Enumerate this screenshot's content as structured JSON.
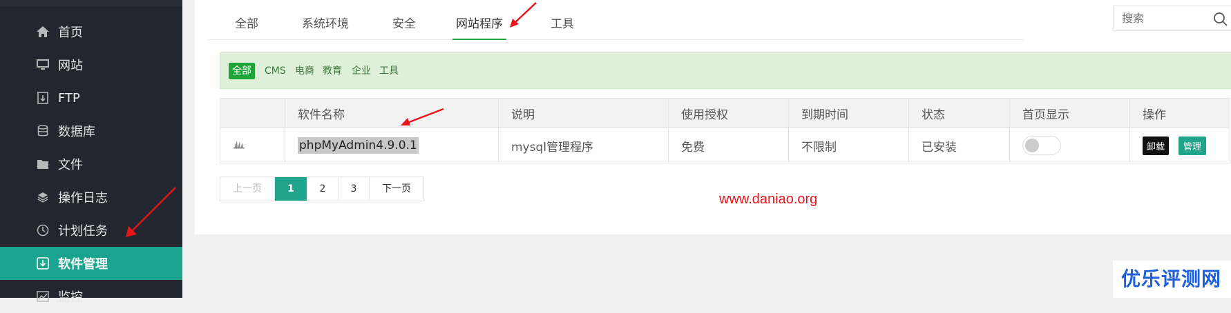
{
  "sidebar": {
    "items": [
      {
        "label": "首页",
        "icon": "home-icon"
      },
      {
        "label": "网站",
        "icon": "monitor-icon"
      },
      {
        "label": "FTP",
        "icon": "ftp-icon"
      },
      {
        "label": "数据库",
        "icon": "database-icon"
      },
      {
        "label": "文件",
        "icon": "folder-icon"
      },
      {
        "label": "操作日志",
        "icon": "layers-icon"
      },
      {
        "label": "计划任务",
        "icon": "clock-icon"
      },
      {
        "label": "软件管理",
        "icon": "download-icon",
        "active": true
      },
      {
        "label": "监控",
        "icon": "chart-icon"
      }
    ]
  },
  "tabs": [
    "全部",
    "系统环境",
    "安全",
    "网站程序",
    "工具"
  ],
  "active_tab": "网站程序",
  "search": {
    "placeholder": "搜索"
  },
  "filters": [
    "全部",
    "CMS",
    "电商",
    "教育",
    "企业",
    "工具"
  ],
  "table": {
    "headers": [
      "",
      "软件名称",
      "说明",
      "使用授权",
      "到期时间",
      "状态",
      "首页显示",
      "操作"
    ],
    "rows": [
      {
        "name": "phpMyAdmin4.9.0.1",
        "desc": "mysql管理程序",
        "license": "免费",
        "expire": "不限制",
        "status": "已安装",
        "uninstall": "卸载",
        "manage": "管理"
      }
    ]
  },
  "pagination": {
    "prev": "上一页",
    "pages": [
      "1",
      "2",
      "3"
    ],
    "current": "1",
    "next": "下一页"
  },
  "watermarks": {
    "url": "www.daniao.org",
    "brand": "优乐评测网"
  },
  "colors": {
    "sidebar_bg": "#23262e",
    "accent": "#1aa38e",
    "green": "#20a53a",
    "arrow": "#e8151b"
  }
}
